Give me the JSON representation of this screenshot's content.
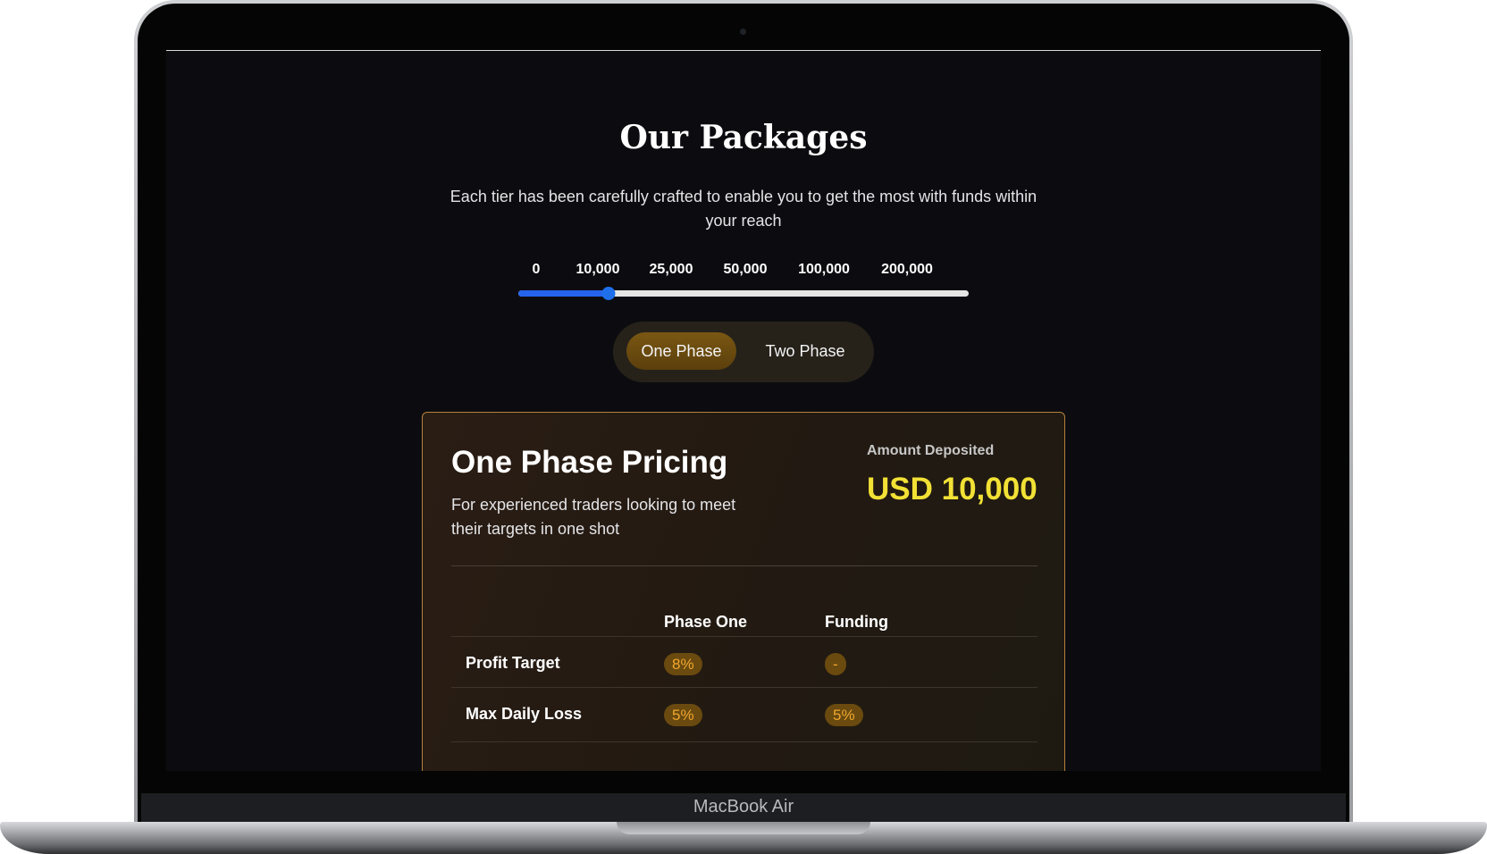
{
  "device": {
    "label": "MacBook Air"
  },
  "page": {
    "title": "Our Packages",
    "subtitle": "Each tier has been carefully crafted to enable you to get the most with funds within your reach"
  },
  "slider": {
    "ticks": [
      "0",
      "10,000",
      "25,000",
      "50,000",
      "100,000",
      "200,000"
    ],
    "selected": "10,000",
    "fill_fraction": 0.2,
    "colors": {
      "fill": "#2563eb",
      "track": "#e5e5e5"
    }
  },
  "toggle": {
    "options": [
      "One Phase",
      "Two Phase"
    ],
    "active": "One Phase"
  },
  "card": {
    "title": "One Phase Pricing",
    "description": "For experienced traders looking to meet their targets in one shot",
    "deposit_label": "Amount Deposited",
    "deposit_value": "USD 10,000",
    "table": {
      "columns": [
        "Phase One",
        "Funding"
      ],
      "rows": [
        {
          "label": "Profit Target",
          "values": [
            "8%",
            "-"
          ]
        },
        {
          "label": "Max Daily Loss",
          "values": [
            "5%",
            "5%"
          ]
        }
      ]
    }
  },
  "colors": {
    "accent_gold": "#f2e135",
    "pill_bg": "#6a4a0f",
    "pill_text": "#f0a72e",
    "card_border": "#b5813a",
    "screen_bg": "#0c0c10"
  }
}
